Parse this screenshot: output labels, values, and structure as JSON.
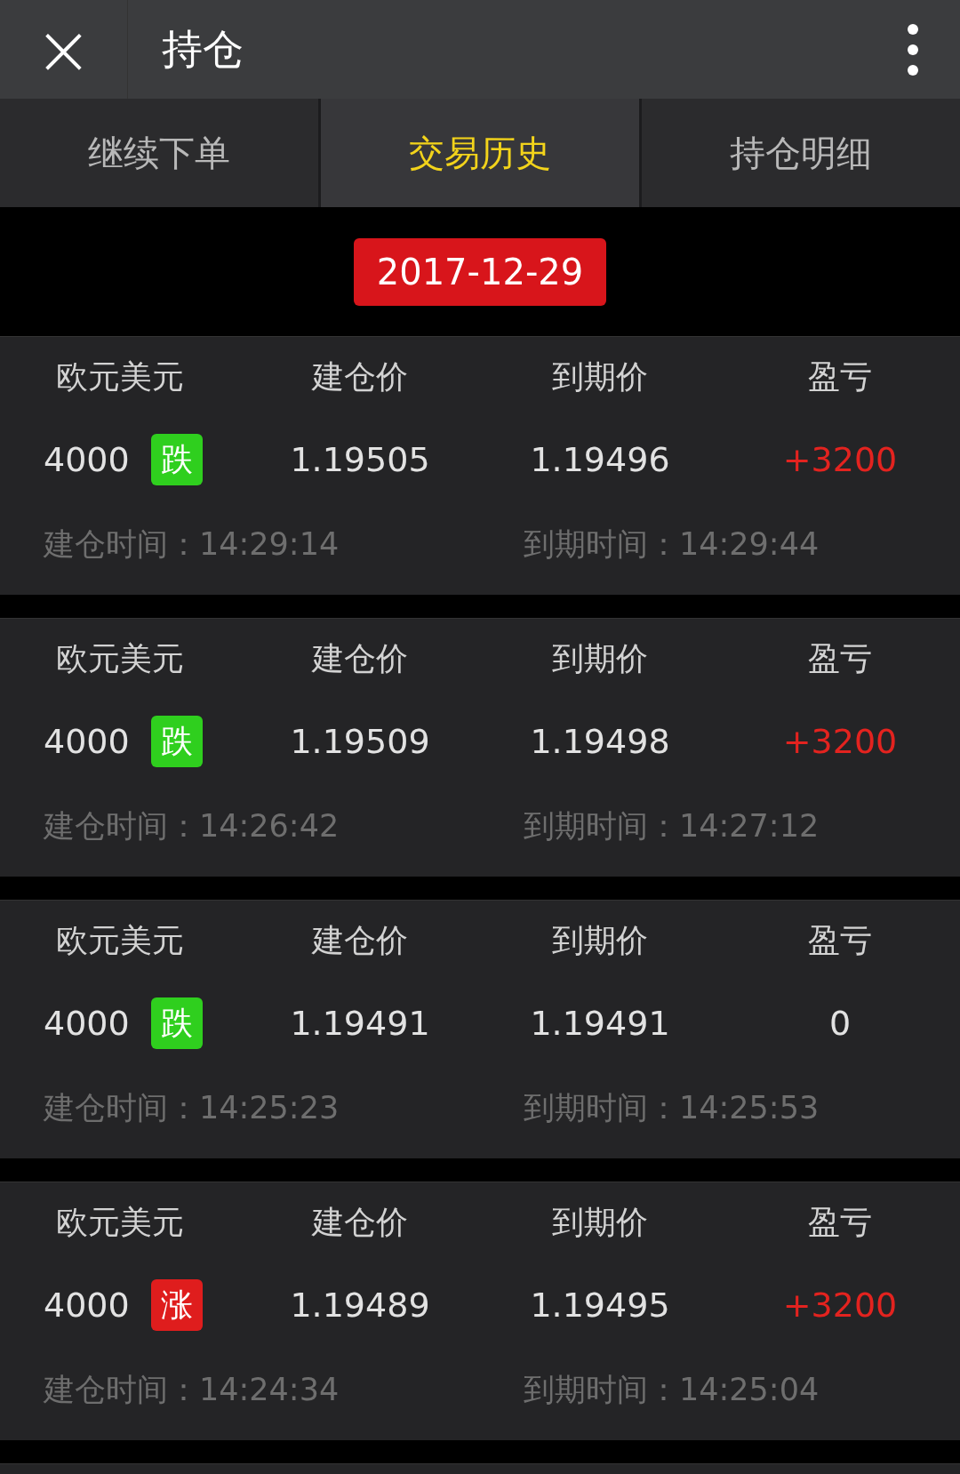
{
  "header": {
    "close": "×",
    "title": "持仓"
  },
  "tabs": [
    {
      "label": "继续下单",
      "selected": false
    },
    {
      "label": "交易历史",
      "selected": true
    },
    {
      "label": "持仓明细",
      "selected": false
    }
  ],
  "date": "2017-12-29",
  "trades": [
    {
      "pair": "欧元美元",
      "open_label": "建仓价",
      "close_label": "到期价",
      "pl_label": "盈亏",
      "amount": "4000",
      "direction": {
        "kind": "down",
        "label": "跌"
      },
      "open_price": "1.19505",
      "close_price": "1.19496",
      "profit": "+3200",
      "profitable": true,
      "open_time": "建仓时间：14:29:14",
      "close_time": "到期时间：14:29:44"
    },
    {
      "pair": "欧元美元",
      "open_label": "建仓价",
      "close_label": "到期价",
      "pl_label": "盈亏",
      "amount": "4000",
      "direction": {
        "kind": "down",
        "label": "跌"
      },
      "open_price": "1.19509",
      "close_price": "1.19498",
      "profit": "+3200",
      "profitable": true,
      "open_time": "建仓时间：14:26:42",
      "close_time": "到期时间：14:27:12"
    },
    {
      "pair": "欧元美元",
      "open_label": "建仓价",
      "close_label": "到期价",
      "pl_label": "盈亏",
      "amount": "4000",
      "direction": {
        "kind": "down",
        "label": "跌"
      },
      "open_price": "1.19491",
      "close_price": "1.19491",
      "profit": "0",
      "profitable": false,
      "open_time": "建仓时间：14:25:23",
      "close_time": "到期时间：14:25:53"
    },
    {
      "pair": "欧元美元",
      "open_label": "建仓价",
      "close_label": "到期价",
      "pl_label": "盈亏",
      "amount": "4000",
      "direction": {
        "kind": "up",
        "label": "涨"
      },
      "open_price": "1.19489",
      "close_price": "1.19495",
      "profit": "+3200",
      "profitable": true,
      "open_time": "建仓时间：14:24:34",
      "close_time": "到期时间：14:25:04"
    }
  ]
}
